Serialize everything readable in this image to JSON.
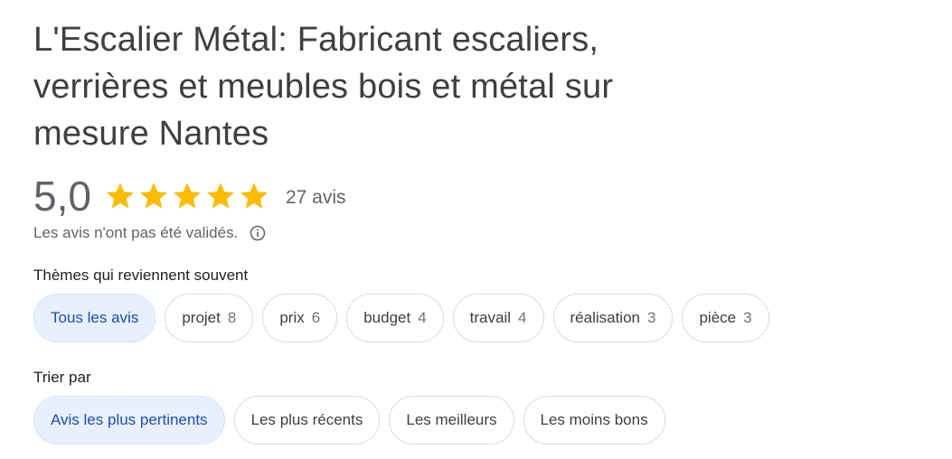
{
  "header": {
    "title": "L'Escalier Métal: Fabricant escaliers, verrières et meubles bois et métal sur mesure Nantes"
  },
  "rating": {
    "score": "5,0",
    "stars": 5,
    "star_color": "#fbbc04",
    "count_label": "27 avis",
    "note": "Les avis n'ont pas été validés.",
    "info_icon": "info-icon"
  },
  "themes": {
    "label": "Thèmes qui reviennent souvent",
    "chips": [
      {
        "label": "Tous les avis",
        "count": "",
        "selected": true
      },
      {
        "label": "projet",
        "count": "8",
        "selected": false
      },
      {
        "label": "prix",
        "count": "6",
        "selected": false
      },
      {
        "label": "budget",
        "count": "4",
        "selected": false
      },
      {
        "label": "travail",
        "count": "4",
        "selected": false
      },
      {
        "label": "réalisation",
        "count": "3",
        "selected": false
      },
      {
        "label": "pièce",
        "count": "3",
        "selected": false
      }
    ]
  },
  "sort": {
    "label": "Trier par",
    "options": [
      {
        "label": "Avis les plus pertinents",
        "selected": true
      },
      {
        "label": "Les plus récents",
        "selected": false
      },
      {
        "label": "Les meilleurs",
        "selected": false
      },
      {
        "label": "Les moins bons",
        "selected": false
      }
    ]
  },
  "colors": {
    "selected_bg": "#e8f0fe",
    "selected_text": "#1a4fb0",
    "chip_border": "#dadce0"
  }
}
